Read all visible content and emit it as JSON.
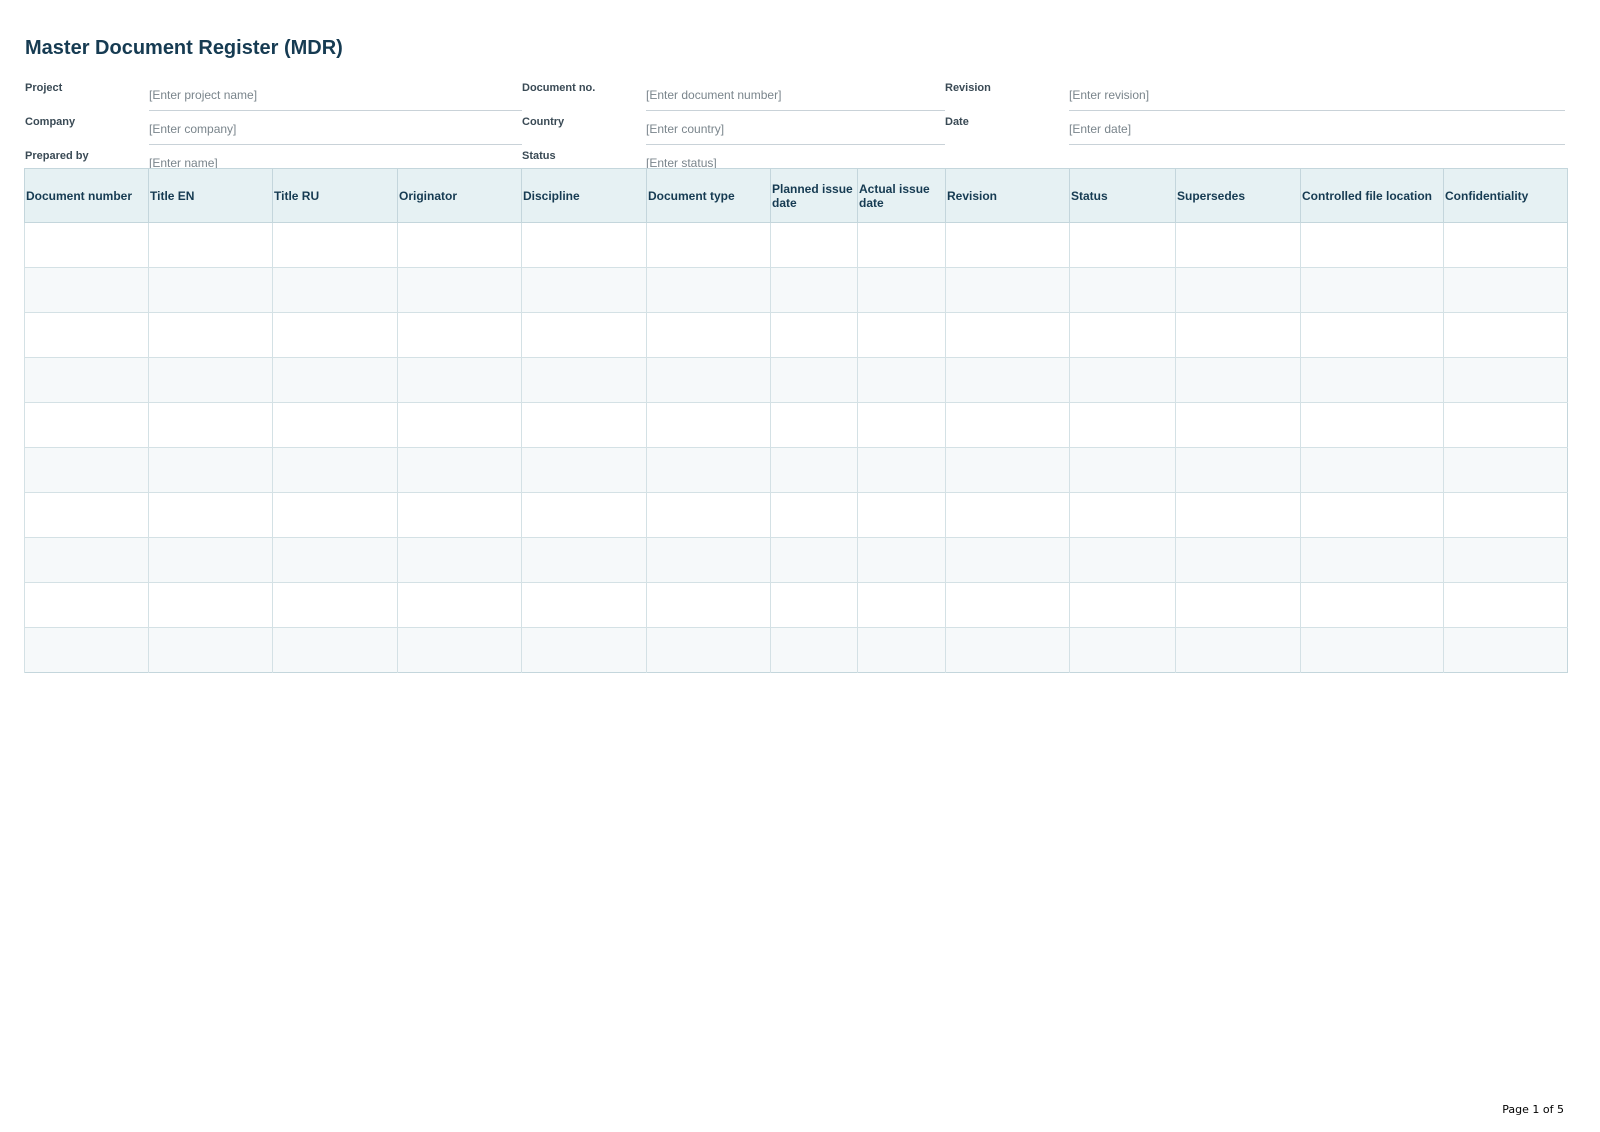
{
  "page": {
    "title": "Master Document Register (MDR)",
    "footer": "Page 1 of 5"
  },
  "meta": {
    "rows": [
      [
        {
          "label": "Project",
          "value": "[Enter project name]"
        },
        {
          "label": "Document no.",
          "value": "[Enter document number]"
        },
        {
          "label": "Revision",
          "value": "[Enter revision]"
        }
      ],
      [
        {
          "label": "Company",
          "value": "[Enter company]"
        },
        {
          "label": "Country",
          "value": "[Enter country]"
        },
        {
          "label": "Date",
          "value": "[Enter date]"
        }
      ],
      [
        {
          "label": "Prepared by",
          "value": "[Enter name]"
        },
        {
          "label": "Status",
          "value": "[Enter status]"
        },
        {
          "label": "",
          "value": ""
        }
      ]
    ]
  },
  "table": {
    "columns": [
      "Document number",
      "Title EN",
      "Title RU",
      "Originator",
      "Discipline",
      "Document type",
      "Planned issue date",
      "Actual issue date",
      "Revision",
      "Status",
      "Supersedes",
      "Controlled file location",
      "Confidentiality"
    ],
    "rows": [
      [
        "",
        "",
        "",
        "",
        "",
        "",
        "",
        "",
        "",
        "",
        "",
        "",
        ""
      ],
      [
        "",
        "",
        "",
        "",
        "",
        "",
        "",
        "",
        "",
        "",
        "",
        "",
        ""
      ],
      [
        "",
        "",
        "",
        "",
        "",
        "",
        "",
        "",
        "",
        "",
        "",
        "",
        ""
      ],
      [
        "",
        "",
        "",
        "",
        "",
        "",
        "",
        "",
        "",
        "",
        "",
        "",
        ""
      ],
      [
        "",
        "",
        "",
        "",
        "",
        "",
        "",
        "",
        "",
        "",
        "",
        "",
        ""
      ],
      [
        "",
        "",
        "",
        "",
        "",
        "",
        "",
        "",
        "",
        "",
        "",
        "",
        ""
      ],
      [
        "",
        "",
        "",
        "",
        "",
        "",
        "",
        "",
        "",
        "",
        "",
        "",
        ""
      ],
      [
        "",
        "",
        "",
        "",
        "",
        "",
        "",
        "",
        "",
        "",
        "",
        "",
        ""
      ],
      [
        "",
        "",
        "",
        "",
        "",
        "",
        "",
        "",
        "",
        "",
        "",
        "",
        ""
      ],
      [
        "",
        "",
        "",
        "",
        "",
        "",
        "",
        "",
        "",
        "",
        "",
        "",
        ""
      ]
    ]
  },
  "colors": {
    "header_bg": "#e6f1f3",
    "title": "#163b52",
    "grid": "#c4d6dc",
    "alt_row": "#f6f9fa"
  }
}
